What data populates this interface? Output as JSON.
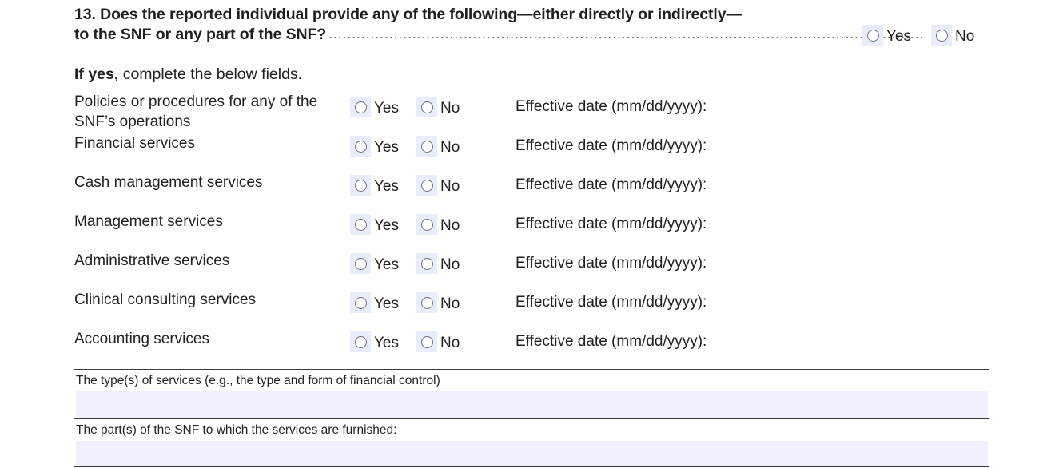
{
  "question": {
    "number": "13.",
    "line1": "13. Does the reported individual provide any of the following—either directly or indirectly—",
    "line2": "to the SNF or any part of the SNF?",
    "leader": "................................................................................................................................",
    "yes_label": "Yes",
    "no_label": "No"
  },
  "instruction": {
    "bold": "If yes,",
    "rest": " complete the below fields."
  },
  "labels": {
    "yes": "Yes",
    "no": "No",
    "effective_date": "Effective date (mm/dd/yyyy):"
  },
  "rows": [
    {
      "label": "Policies or procedures for any of the SNF’s operations",
      "yes": "Yes",
      "no": "No",
      "date_label": "Effective date (mm/dd/yyyy):",
      "date_value": ""
    },
    {
      "label": "Financial services",
      "yes": "Yes",
      "no": "No",
      "date_label": "Effective date (mm/dd/yyyy):",
      "date_value": ""
    },
    {
      "label": "Cash management services",
      "yes": "Yes",
      "no": "No",
      "date_label": "Effective date (mm/dd/yyyy):",
      "date_value": ""
    },
    {
      "label": "Management services",
      "yes": "Yes",
      "no": "No",
      "date_label": "Effective date (mm/dd/yyyy):",
      "date_value": ""
    },
    {
      "label": "Administrative services",
      "yes": "Yes",
      "no": "No",
      "date_label": "Effective date (mm/dd/yyyy):",
      "date_value": ""
    },
    {
      "label": "Clinical consulting services",
      "yes": "Yes",
      "no": "No",
      "date_label": "Effective date (mm/dd/yyyy):",
      "date_value": ""
    },
    {
      "label": "Accounting services",
      "yes": "Yes",
      "no": "No",
      "date_label": "Effective date (mm/dd/yyyy):",
      "date_value": ""
    }
  ],
  "text_blocks": [
    {
      "label": "The type(s) of services (e.g., the type and form of financial control)",
      "value": ""
    },
    {
      "label": "The part(s) of the SNF to which the services are furnished:",
      "value": ""
    }
  ],
  "colors": {
    "field_fill": "#eef0fc",
    "radio_fill": "#e9ecfa",
    "rule": "#3d3d3d",
    "underline": "#8d93a8",
    "text": "#231f20"
  }
}
